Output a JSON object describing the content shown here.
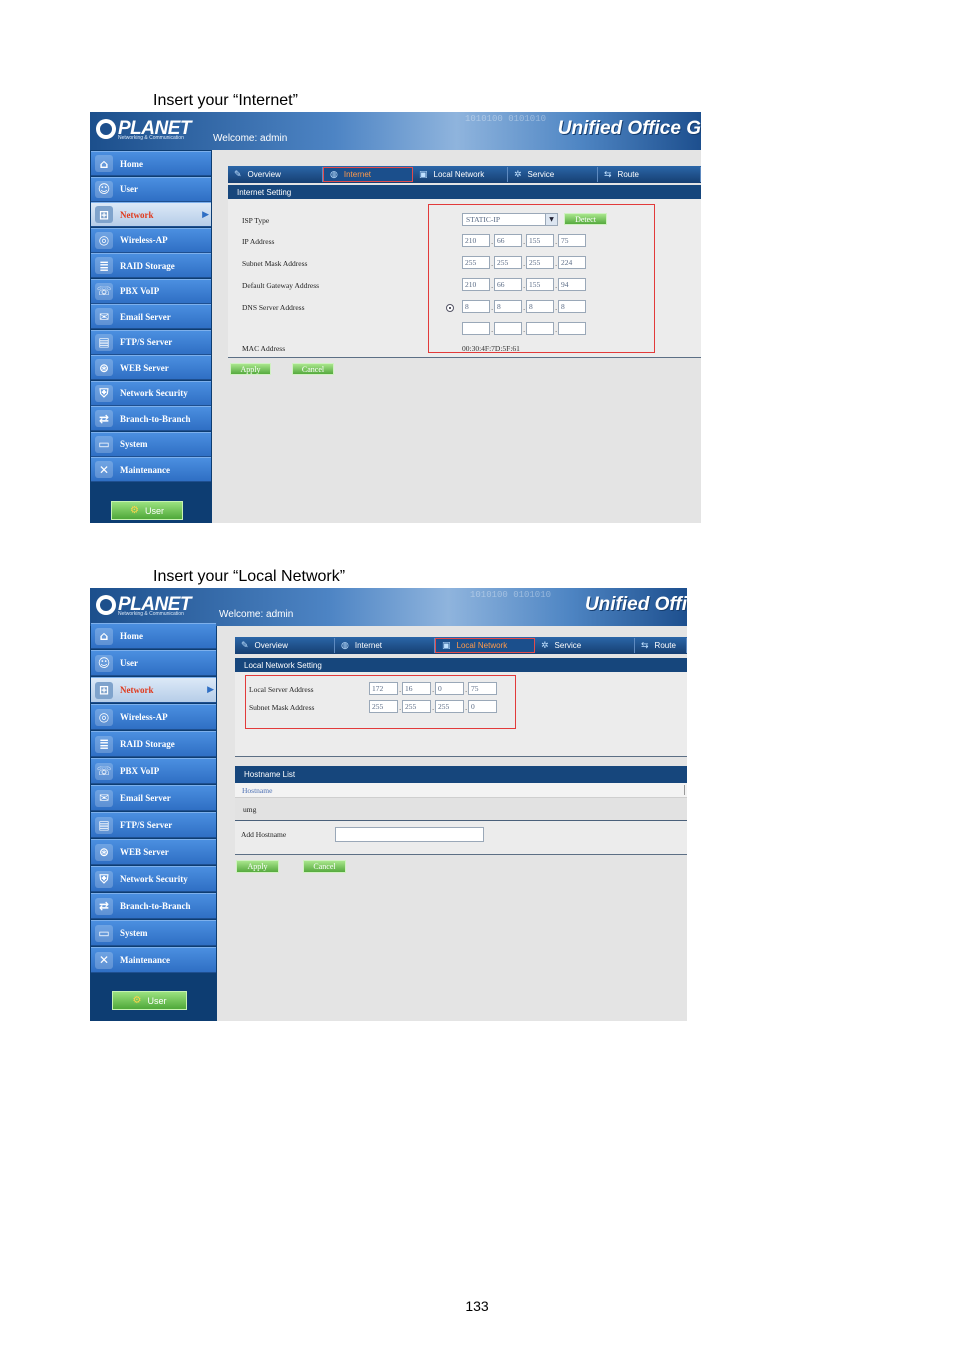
{
  "captions": {
    "internet": "Insert your “Internet”",
    "local": "Insert your “Local Network”"
  },
  "page_number": "133",
  "header": {
    "logo": "PLANET",
    "logo_sub": "Networking & Communication",
    "welcome": "Welcome: admin",
    "binary_overlay": "1010100 0101010",
    "brand_1": "Unified Office G",
    "brand_2": "Unified Offi"
  },
  "nav": {
    "items": [
      {
        "label": "Home",
        "icon": "home-icon",
        "glyph": "⌂"
      },
      {
        "label": "User",
        "icon": "user-icon",
        "glyph": "☺"
      },
      {
        "label": "Network",
        "icon": "network-icon",
        "glyph": "⊞"
      },
      {
        "label": "Wireless-AP",
        "icon": "wireless-icon",
        "glyph": "◎"
      },
      {
        "label": "RAID Storage",
        "icon": "storage-icon",
        "glyph": "≣"
      },
      {
        "label": "PBX VoIP",
        "icon": "phone-icon",
        "glyph": "☏"
      },
      {
        "label": "Email Server",
        "icon": "email-icon",
        "glyph": "✉"
      },
      {
        "label": "FTP/S Server",
        "icon": "folder-icon",
        "glyph": "▤"
      },
      {
        "label": "WEB Server",
        "icon": "web-icon",
        "glyph": "⊛"
      },
      {
        "label": "Network Security",
        "icon": "security-icon",
        "glyph": "⛨"
      },
      {
        "label": "Branch-to-Branch",
        "icon": "branch-icon",
        "glyph": "⇄"
      },
      {
        "label": "System",
        "icon": "system-icon",
        "glyph": "▭"
      },
      {
        "label": "Maintenance",
        "icon": "tools-icon",
        "glyph": "✕"
      }
    ],
    "active": "Network",
    "user_button": "User"
  },
  "tabs": [
    {
      "label": "Overview",
      "icon": "overview-icon",
      "glyph": "✎"
    },
    {
      "label": "Internet",
      "icon": "globe-icon",
      "glyph": "◍"
    },
    {
      "label": "Local Network",
      "icon": "computer-icon",
      "glyph": "▣"
    },
    {
      "label": "Service",
      "icon": "service-icon",
      "glyph": "✲"
    },
    {
      "label": "Route",
      "icon": "route-icon",
      "glyph": "⇆"
    }
  ],
  "internet": {
    "section_title": "Internet Setting",
    "isp_type_label": "ISP Type",
    "isp_type_value": "STATIC-IP",
    "detect_label": "Detect",
    "ip_label": "IP Address",
    "ip": [
      "210",
      "66",
      "155",
      "75"
    ],
    "mask_label": "Subnet Mask Address",
    "mask": [
      "255",
      "255",
      "255",
      "224"
    ],
    "gateway_label": "Default Gateway Address",
    "gateway": [
      "210",
      "66",
      "155",
      "94"
    ],
    "dns_label": "DNS Server Address",
    "dns1": [
      "8",
      "8",
      "8",
      "8"
    ],
    "dns2": [
      "",
      "",
      "",
      ""
    ],
    "mac_label": "MAC Address",
    "mac_value": "00:30:4F:7D:5F:61",
    "apply": "Apply",
    "cancel": "Cancel"
  },
  "local": {
    "section_title": "Local Network Setting",
    "server_label": "Local Server Address",
    "server": [
      "172",
      "16",
      "0",
      "75"
    ],
    "mask_label": "Subnet Mask Address",
    "mask": [
      "255",
      "255",
      "255",
      "0"
    ],
    "hostname_list_title": "Hostname List",
    "hostname_col": "Hostname",
    "hostname_row": "umg",
    "add_hostname_label": "Add Hostname",
    "add_hostname_value": "",
    "apply": "Apply",
    "cancel": "Cancel"
  }
}
